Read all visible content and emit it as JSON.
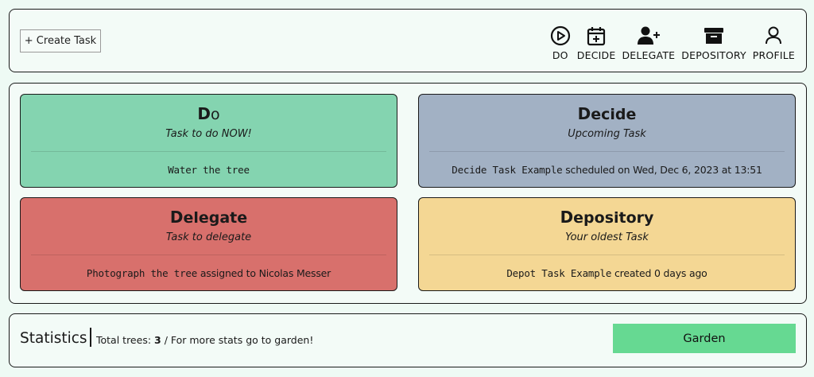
{
  "topbar": {
    "create_label": "+ Create Task",
    "nav": [
      {
        "label": "DO",
        "icon": "play-circle-icon"
      },
      {
        "label": "DECIDE",
        "icon": "calendar-plus-icon"
      },
      {
        "label": "DELEGATE",
        "icon": "user-plus-icon"
      },
      {
        "label": "DEPOSITORY",
        "icon": "archive-box-icon"
      },
      {
        "label": "PROFILE",
        "icon": "user-icon"
      }
    ]
  },
  "cards": {
    "do": {
      "title_first": "D",
      "title_rest": "o",
      "subtitle": "Task to do NOW!",
      "task": "Water the tree",
      "color": "#84d4b0"
    },
    "decide": {
      "title_first": "D",
      "title_rest": "ecide",
      "subtitle": "Upcoming Task",
      "task": "Decide Task Example",
      "detail": " scheduled on Wed, Dec 6, 2023 at 13:51",
      "color": "#a2b1c4"
    },
    "delegate": {
      "title_first": "D",
      "title_rest": "elegate",
      "subtitle": "Task to delegate",
      "task": "Photograph the tree",
      "detail": " assigned to Nicolas Messer",
      "color": "#d8706c"
    },
    "depository": {
      "title_first": "D",
      "title_rest": "epository",
      "subtitle": "Your oldest Task",
      "task": "Depot Task Example",
      "detail": " created 0 days ago",
      "color": "#f4d794"
    }
  },
  "stats": {
    "title": "Statistics",
    "prefix": "Total trees: ",
    "count": "3",
    "suffix": " / For more stats go to garden!",
    "garden_label": "Garden",
    "garden_color": "#66d992"
  }
}
